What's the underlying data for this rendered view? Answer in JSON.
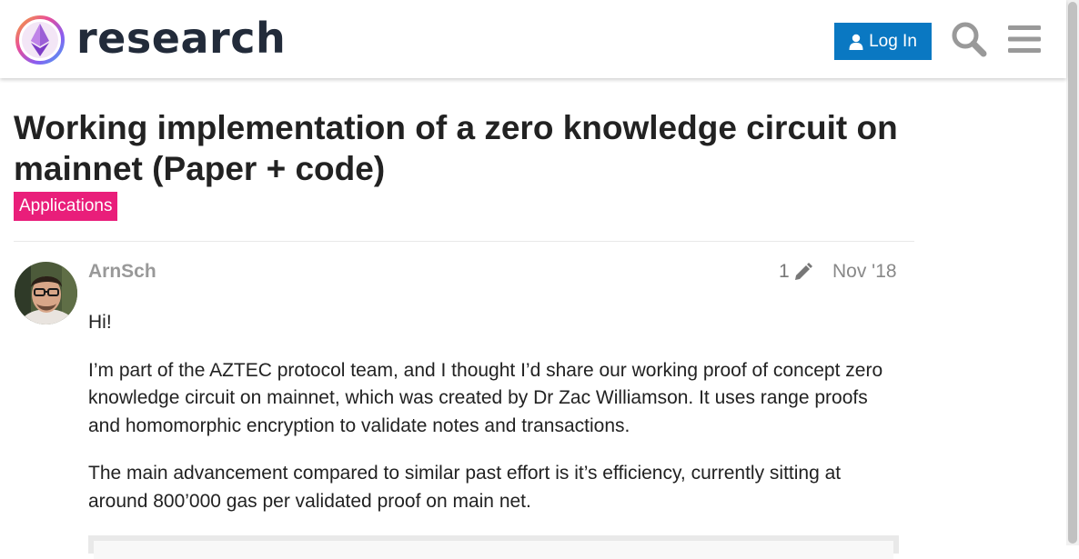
{
  "header": {
    "logo_text": "research",
    "login_label": "Log In",
    "search_icon": "search-icon",
    "menu_icon": "hamburger-menu-icon",
    "accent_color": "#0a78c2"
  },
  "topic": {
    "title": "Working implementation of a zero knowledge circuit on mainnet (Paper + code)",
    "category": "Applications",
    "category_color": "#e91e7a"
  },
  "post": {
    "username": "ArnSch",
    "edit_count": "1",
    "date": "Nov '18",
    "paragraphs": [
      "Hi!",
      "I’m part of the AZTEC protocol team, and I thought I’d share our working proof of concept zero knowledge circuit on mainnet, which was created by Dr Zac Williamson. It uses range proofs and homomorphic encryption to validate notes and transactions.",
      "The main advancement compared to similar past effort is it’s efficiency, currently sitting at around 800’000 gas per validated proof on main net."
    ]
  }
}
